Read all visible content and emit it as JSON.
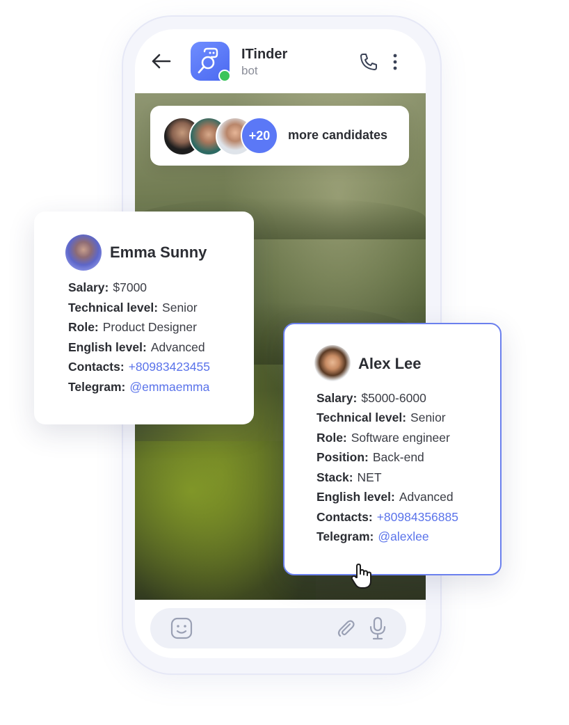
{
  "header": {
    "bot_name": "ITinder",
    "bot_sub": "bot"
  },
  "candidates_pill": {
    "more_count": "+20",
    "more_label": "more candidates"
  },
  "emma": {
    "name": "Emma Sunny",
    "rows": [
      {
        "key": "Salary:",
        "value": "$7000"
      },
      {
        "key": "Technical level:",
        "value": "Senior"
      },
      {
        "key": "Role:",
        "value": "Product Designer"
      },
      {
        "key": "English level:",
        "value": "Advanced"
      },
      {
        "key": "Contacts:",
        "value": "+80983423455"
      },
      {
        "key": "Telegram:",
        "value": "@emmaemma"
      }
    ]
  },
  "alex": {
    "name": "Alex Lee",
    "rows": [
      {
        "key": "Salary:",
        "value": "$5000-6000"
      },
      {
        "key": "Technical level:",
        "value": "Senior"
      },
      {
        "key": "Role:",
        "value": "Software engineer"
      },
      {
        "key": "Position:",
        "value": "Back-end"
      },
      {
        "key": "Stack:",
        "value": "NET"
      },
      {
        "key": "English level:",
        "value": "Advanced"
      },
      {
        "key": "Contacts:",
        "value": "+80984356885"
      },
      {
        "key": "Telegram:",
        "value": "@alexlee"
      }
    ]
  },
  "icons": {
    "back": "arrow-left-icon",
    "call": "phone-icon",
    "more": "more-vertical-icon",
    "emoji": "emoji-icon",
    "attach": "paperclip-icon",
    "mic": "microphone-icon"
  },
  "colors": {
    "accent": "#5b78f6",
    "link": "#5a73ea",
    "online": "#3bc45a",
    "card_border": "#6b80ee"
  }
}
